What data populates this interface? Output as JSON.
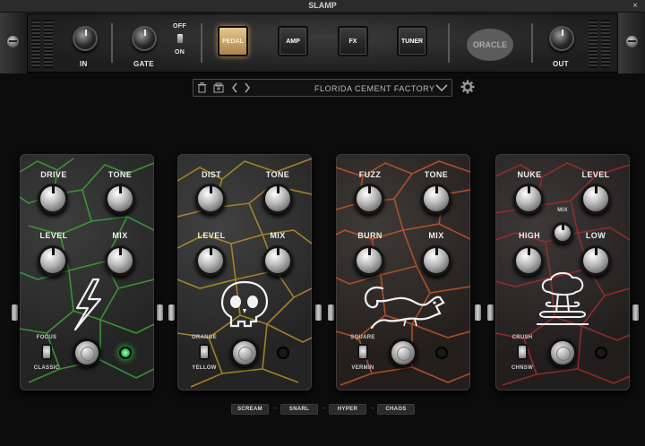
{
  "window": {
    "title": "SLAMP",
    "close_glyph": "×"
  },
  "header": {
    "in_label": "IN",
    "gate_label": "GATE",
    "gate_off": "OFF",
    "gate_on": "ON",
    "modes": [
      "PEDAL",
      "AMP",
      "FX",
      "TUNER"
    ],
    "active_mode": "PEDAL",
    "logo": "ORACLE",
    "out_label": "OUT"
  },
  "preset": {
    "name": "FLORIDA CEMENT FACTORY",
    "icons": [
      "trash-icon",
      "save-icon",
      "prev-icon",
      "next-icon",
      "chevron-down-icon"
    ],
    "settings_icon": "gear-icon"
  },
  "pedals": [
    {
      "id": "scream",
      "knobs": [
        "DRIVE",
        "TONE",
        "LEVEL",
        "MIX"
      ],
      "toggle_top": "FOCUS",
      "toggle_bottom": "CLASSIC",
      "led_on": true,
      "crack_color": "#3fa43a"
    },
    {
      "id": "snarl",
      "knobs": [
        "DIST",
        "TONE",
        "LEVEL",
        "MIX"
      ],
      "toggle_top": "ORANGE",
      "toggle_bottom": "YELLOW",
      "led_on": false,
      "crack_color": "#b98f2a"
    },
    {
      "id": "hyper",
      "knobs": [
        "FUZZ",
        "TONE",
        "BURN",
        "MIX"
      ],
      "toggle_top": "SQUARE",
      "toggle_bottom": "VERMIN",
      "led_on": false,
      "crack_color": "#c4562b"
    },
    {
      "id": "chaos",
      "knobs": [
        "NUKE",
        "LEVEL",
        "HIGH",
        "LOW"
      ],
      "center_knob": "MIX",
      "toggle_top": "CRUSH",
      "toggle_bottom": "CHNSW",
      "led_on": false,
      "crack_color": "#a12e2a"
    }
  ],
  "chain": [
    "SCREAM",
    "SNARL",
    "HYPER",
    "CHAOS"
  ],
  "chain_arrow": "→"
}
